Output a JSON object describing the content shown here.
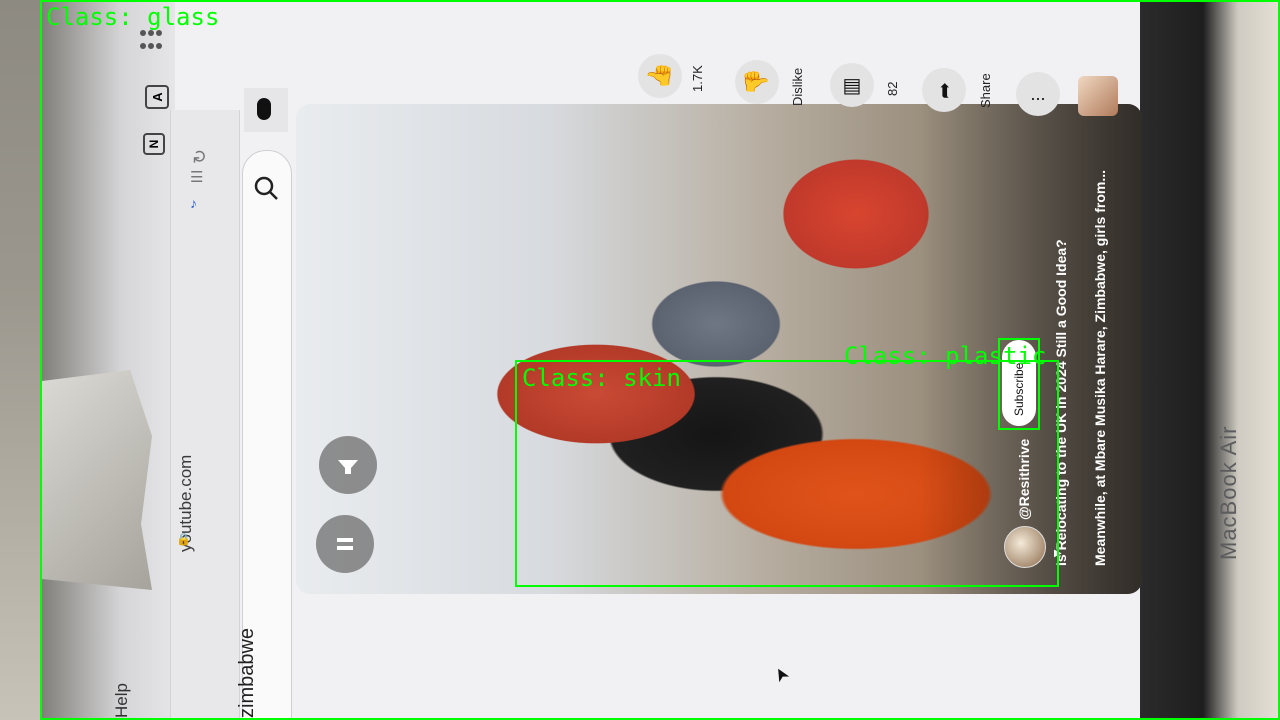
{
  "browser": {
    "url": "youtube.com",
    "search_query": "zimbabwe",
    "help_label": "Help"
  },
  "laptop": {
    "brand_label": "MacBook Air"
  },
  "short": {
    "channel": "@Resithrive",
    "subscribe_label": "Subscribe",
    "title": "Is Relocating to the UK in 2024 Still a Good Idea?",
    "description": "Meanwhile, at Mbare Musika Harare, Zimbabwe, girls from..."
  },
  "actions": {
    "like_count": "1.7K",
    "dislike_label": "Dislike",
    "comment_count": "82",
    "share_label": "Share",
    "more_label": "..."
  },
  "detections": [
    {
      "label": "Class: glass",
      "color": "#00ff00"
    },
    {
      "label": "Class: skin",
      "color": "#00ff00"
    },
    {
      "label": "Class: plastic",
      "color": "#00ff00"
    }
  ]
}
